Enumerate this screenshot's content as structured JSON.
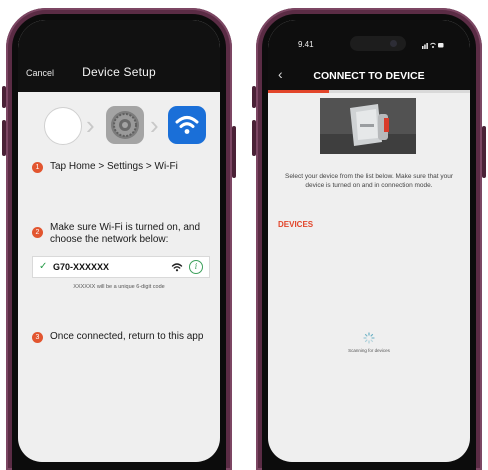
{
  "phone1": {
    "header": {
      "cancel_label": "Cancel",
      "title": "Device Setup"
    },
    "icons": [
      "home-button-icon",
      "settings-gear-icon",
      "wifi-icon"
    ],
    "steps": [
      {
        "number": "1",
        "text": "Tap Home > Settings > Wi-Fi"
      },
      {
        "number": "2",
        "text": "Make sure Wi-Fi is turned on, and choose the network below:"
      },
      {
        "number": "3",
        "text": "Once connected, return to this app"
      }
    ],
    "network": {
      "name": "G70-XXXXXX",
      "note": "XXXXXX will be a unique 6-digit code"
    },
    "colors": {
      "accent": "#e2552f",
      "check": "#2a9d4a",
      "wifi_app": "#1a6fd8"
    }
  },
  "phone2": {
    "status": {
      "time": "9.41"
    },
    "nav": {
      "title": "CONNECT TO DEVICE"
    },
    "progress": 0.3,
    "description": "Select your device from the list below. Make sure that your device is turned on and in connection mode.",
    "devices_heading": "DEVICES",
    "scanning_text": "Scanning for devices",
    "colors": {
      "accent": "#e2452a"
    }
  }
}
